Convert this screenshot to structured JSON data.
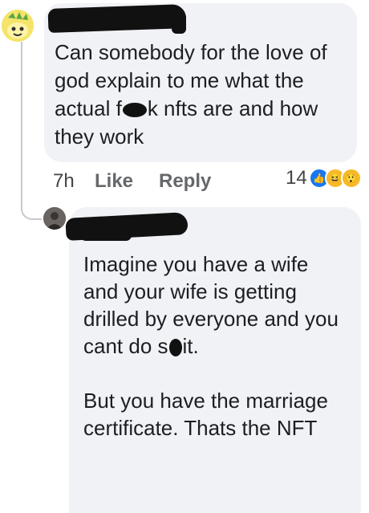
{
  "comment1": {
    "text_before": "Can somebody for the love of god explain to me what the actual f",
    "text_after": "k nfts are and how they work",
    "time": "7h",
    "like_label": "Like",
    "reply_label": "Reply",
    "reaction_count": "14"
  },
  "reply1": {
    "text_before": "Imagine you have a wife and your wife is getting drilled by everyone and you cant do s",
    "text_after": "it.",
    "second_paragraph": "But you have the marriage certificate. Thats the NFT"
  }
}
